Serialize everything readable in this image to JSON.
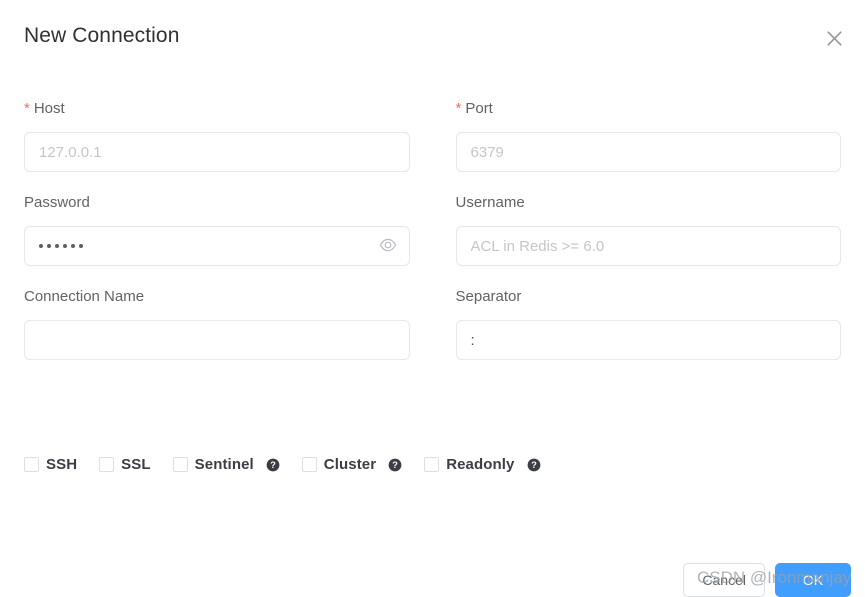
{
  "dialog": {
    "title": "New Connection",
    "close_icon": "close-icon"
  },
  "form": {
    "rows": [
      {
        "left": {
          "label": "Host",
          "required": true,
          "required_marker": "*",
          "placeholder": "127.0.0.1",
          "value": ""
        },
        "right": {
          "label": "Port",
          "required": true,
          "required_marker": "*",
          "placeholder": "6379",
          "value": ""
        }
      },
      {
        "left": {
          "label": "Password",
          "required": false,
          "placeholder": "",
          "value": "······",
          "masked_char_count": 6,
          "suffix_icon": "eye-icon"
        },
        "right": {
          "label": "Username",
          "required": false,
          "placeholder": "ACL in Redis >= 6.0",
          "value": ""
        }
      },
      {
        "left": {
          "label": "Connection Name",
          "required": false,
          "placeholder": "",
          "value": ""
        },
        "right": {
          "label": "Separator",
          "required": false,
          "placeholder": "",
          "value": ":"
        }
      }
    ]
  },
  "options": {
    "checkboxes": [
      {
        "label": "SSH",
        "checked": false,
        "help": false
      },
      {
        "label": "SSL",
        "checked": false,
        "help": false
      },
      {
        "label": "Sentinel",
        "checked": false,
        "help": true,
        "help_icon": "help-circle-icon"
      },
      {
        "label": "Cluster",
        "checked": false,
        "help": true,
        "help_icon": "help-circle-icon"
      },
      {
        "label": "Readonly",
        "checked": false,
        "help": true,
        "help_icon": "help-circle-icon"
      }
    ]
  },
  "footer": {
    "cancel_label": "Cancel",
    "ok_label": "OK"
  },
  "watermark": {
    "text": "CSDN @Ironmanjay"
  },
  "colors": {
    "primary": "#409eff",
    "required_star": "#f56c6c",
    "label_text": "#606266",
    "title_text": "#303133",
    "border": "#e6e8eb",
    "placeholder": "#c3c6cc",
    "watermark": "#9aa0a6"
  }
}
